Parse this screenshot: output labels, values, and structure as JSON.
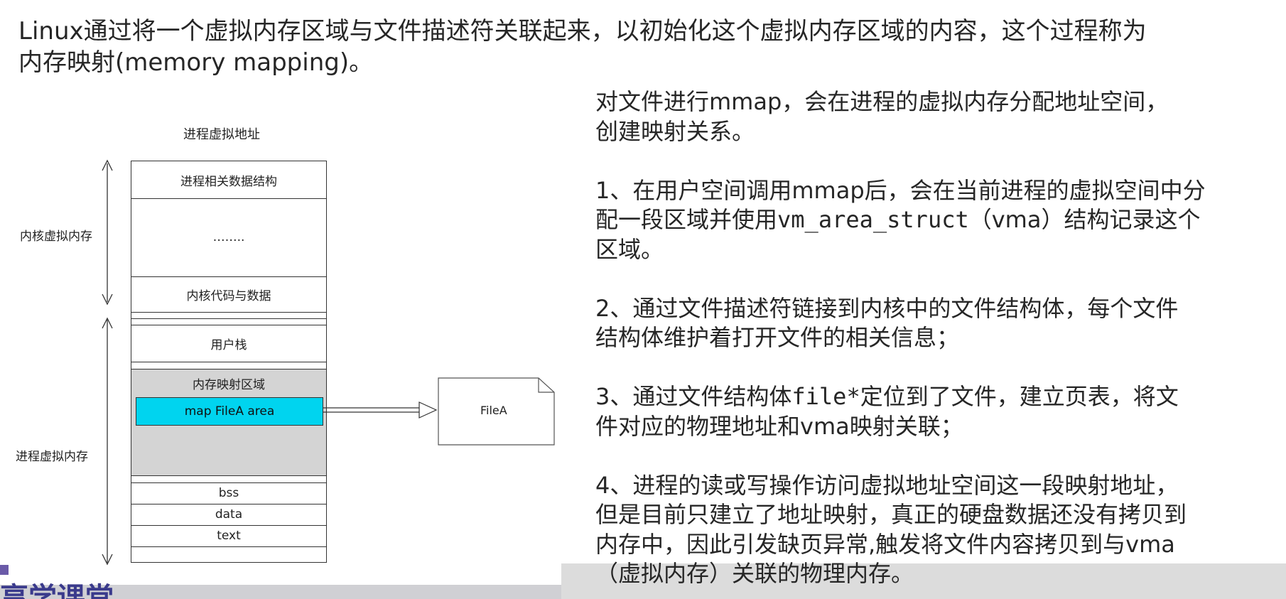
{
  "intro": {
    "line1": "Linux通过将一个虚拟内存区域与文件描述符关联起来，以初始化这个虚拟内存区域的内容，这个过程称为",
    "line2": "内存映射(memory mapping)。"
  },
  "diagram": {
    "title": "进程虚拟地址",
    "kernel_label": "内核虚拟内存",
    "process_label": "进程虚拟内存",
    "segments": {
      "proc_struct": "进程相关数据结构",
      "ellipsis": "……..",
      "kernel_code": "内核代码与数据",
      "user_stack": "用户栈",
      "mmap_region": "内存映射区域",
      "map_area": "map FileA area",
      "bss": "bss",
      "data": "data",
      "text": "text"
    },
    "file_label": "FileA"
  },
  "right": {
    "intro_l1": "对文件进行mmap，会在进程的虚拟内存分配地址空间，",
    "intro_l2": "创建映射关系。",
    "s1_l1": "1、在用户空间调用mmap后，会在当前进程的虚拟空间中分",
    "s1_l2a": "配一段区域并使用",
    "s1_l2_code": "vm_area_struct",
    "s1_l2b": "（vma）结构记录这个",
    "s1_l3": "区域。",
    "s2_l1": "2、通过文件描述符链接到内核中的文件结构体，每个文件",
    "s2_l2": "结构体维护着打开文件的相关信息；",
    "s3_l1a": "3、通过文件结构体",
    "s3_l1_code": "file*",
    "s3_l1b": "定位到了文件，建立页表，将文",
    "s3_l2": "件对应的物理地址和vma映射关联；",
    "s4_l1": "4、进程的读或写操作访问虚拟地址空间这一段映射地址，",
    "s4_l2": "但是目前只建立了地址映射，真正的硬盘数据还没有拷贝到",
    "s4_l3": "内存中，因此引发缺页异常,触发将文件内容拷贝到与vma",
    "s4_l4": "（虚拟内存）关联的物理内存。"
  },
  "footer": {
    "logo_text": "享学课堂"
  }
}
